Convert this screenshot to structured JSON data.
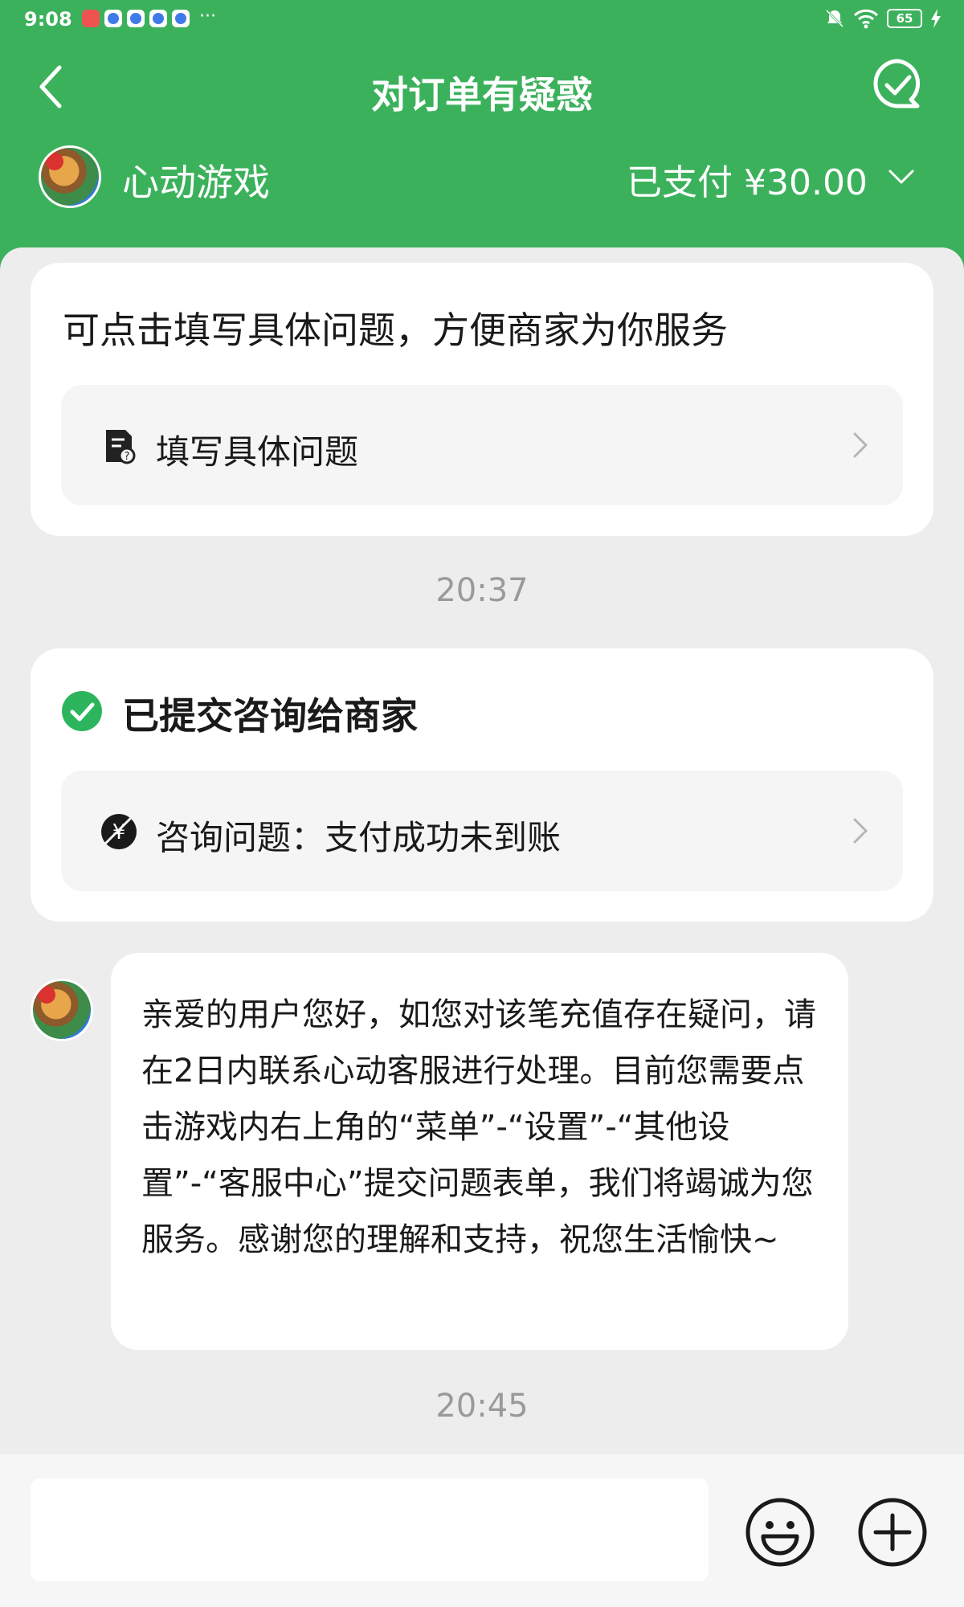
{
  "status_bar": {
    "time": "9:08",
    "more": "···",
    "battery": "65"
  },
  "header": {
    "title": "对订单有疑惑",
    "merchant_name": "心动游戏",
    "payment_status": "已支付 ¥30.00"
  },
  "form_card": {
    "heading": "可点击填写具体问题，方便商家为你服务",
    "action_label": "填写具体问题"
  },
  "timestamps": [
    "20:37",
    "20:45"
  ],
  "submitted_card": {
    "heading": "已提交咨询给商家",
    "question_label": "咨询问题：支付成功未到账"
  },
  "message": {
    "text": "亲爱的用户您好，如您对该笔充值存在疑问，请在2日内联系心动客服进行处理。目前您需要点击游戏内右上角的“菜单”-“设置”-“其他设置”-“客服中心”提交问题表单，我们将竭诚为您服务。感谢您的理解和支持，祝您生活愉快~"
  },
  "input": {
    "placeholder": ""
  },
  "colors": {
    "brand_green": "#3cb15c",
    "background": "#ededed",
    "timestamp_gray": "#9a9a9a"
  },
  "icons": [
    "back-arrow-icon",
    "chat-check-icon",
    "chevron-down-icon",
    "form-edit-icon",
    "chevron-right-icon",
    "check-circle-icon",
    "yuan-icon",
    "emoji-icon",
    "plus-circle-icon"
  ]
}
